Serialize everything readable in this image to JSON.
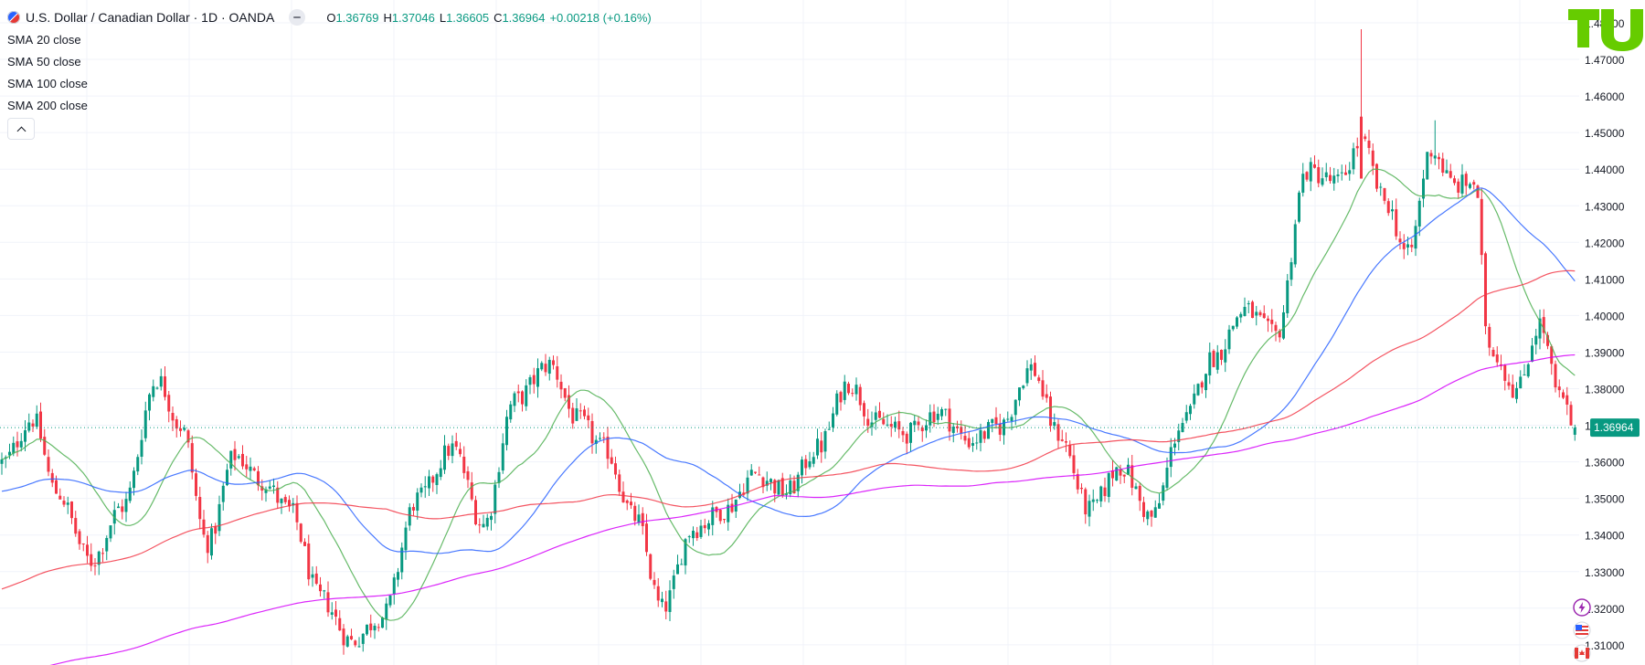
{
  "header": {
    "symbol_title": "U.S. Dollar / Canadian Dollar · 1D · OANDA",
    "open_label": "O",
    "open_value": "1.36769",
    "high_label": "H",
    "high_value": "1.37046",
    "low_label": "L",
    "low_value": "1.36605",
    "close_label": "C",
    "close_value": "1.36964",
    "change": "+0.00218 (+0.16%)"
  },
  "indicators": [
    {
      "name": "SMA",
      "params": "20 close",
      "color": "#4caf50"
    },
    {
      "name": "SMA",
      "params": "50 close",
      "color": "#2962ff"
    },
    {
      "name": "SMA",
      "params": "100 close",
      "color": "#f23645"
    },
    {
      "name": "SMA",
      "params": "200 close",
      "color": "#d500f9"
    }
  ],
  "price_axis": {
    "ticks": [
      "1.48000",
      "1.47000",
      "1.46000",
      "1.45000",
      "1.44000",
      "1.43000",
      "1.42000",
      "1.41000",
      "1.40000",
      "1.39000",
      "1.38000",
      "1.37000",
      "1.36000",
      "1.35000",
      "1.34000",
      "1.33000",
      "1.32000",
      "1.31000"
    ],
    "current_price_label": "1.36964"
  },
  "colors": {
    "up": "#089981",
    "down": "#f23645",
    "grid": "#f0f3fa",
    "axis_text": "#131722",
    "price_line": "#089981"
  },
  "icons": {
    "logo": "tradingview-logo",
    "side": [
      "lightning-icon",
      "us-flag-icon",
      "canada-flag-icon"
    ]
  },
  "chart_data": {
    "type": "candlestick",
    "interval": "1D",
    "ylim": [
      1.305,
      1.482
    ],
    "grid": true,
    "last_close": 1.36964,
    "key_points": [
      {
        "i": 0,
        "price": 1.36
      },
      {
        "i": 8,
        "price": 1.372
      },
      {
        "i": 14,
        "price": 1.352
      },
      {
        "i": 23,
        "price": 1.333
      },
      {
        "i": 31,
        "price": 1.348
      },
      {
        "i": 40,
        "price": 1.383
      },
      {
        "i": 46,
        "price": 1.37
      },
      {
        "i": 53,
        "price": 1.338
      },
      {
        "i": 60,
        "price": 1.362
      },
      {
        "i": 67,
        "price": 1.355
      },
      {
        "i": 74,
        "price": 1.347
      },
      {
        "i": 82,
        "price": 1.323
      },
      {
        "i": 90,
        "price": 1.311
      },
      {
        "i": 98,
        "price": 1.318
      },
      {
        "i": 107,
        "price": 1.35
      },
      {
        "i": 116,
        "price": 1.364
      },
      {
        "i": 124,
        "price": 1.343
      },
      {
        "i": 132,
        "price": 1.377
      },
      {
        "i": 141,
        "price": 1.387
      },
      {
        "i": 148,
        "price": 1.372
      },
      {
        "i": 155,
        "price": 1.364
      },
      {
        "i": 163,
        "price": 1.345
      },
      {
        "i": 170,
        "price": 1.32
      },
      {
        "i": 178,
        "price": 1.342
      },
      {
        "i": 186,
        "price": 1.347
      },
      {
        "i": 194,
        "price": 1.357
      },
      {
        "i": 202,
        "price": 1.352
      },
      {
        "i": 210,
        "price": 1.364
      },
      {
        "i": 218,
        "price": 1.382
      },
      {
        "i": 225,
        "price": 1.371
      },
      {
        "i": 233,
        "price": 1.368
      },
      {
        "i": 241,
        "price": 1.374
      },
      {
        "i": 249,
        "price": 1.366
      },
      {
        "i": 257,
        "price": 1.37
      },
      {
        "i": 265,
        "price": 1.386
      },
      {
        "i": 272,
        "price": 1.368
      },
      {
        "i": 280,
        "price": 1.347
      },
      {
        "i": 288,
        "price": 1.359
      },
      {
        "i": 296,
        "price": 1.345
      },
      {
        "i": 304,
        "price": 1.371
      },
      {
        "i": 312,
        "price": 1.389
      },
      {
        "i": 320,
        "price": 1.402
      },
      {
        "i": 328,
        "price": 1.395
      },
      {
        "i": 336,
        "price": 1.44
      },
      {
        "i": 344,
        "price": 1.437
      },
      {
        "i": 350,
        "price": 1.448
      },
      {
        "i": 356,
        "price": 1.432
      },
      {
        "i": 362,
        "price": 1.417
      },
      {
        "i": 368,
        "price": 1.446
      },
      {
        "i": 374,
        "price": 1.436
      },
      {
        "i": 379,
        "price": 1.437
      },
      {
        "i": 383,
        "price": 1.392
      },
      {
        "i": 390,
        "price": 1.38
      },
      {
        "i": 396,
        "price": 1.398
      },
      {
        "i": 401,
        "price": 1.378
      },
      {
        "i": 405,
        "price": 1.37
      }
    ],
    "series": [
      {
        "name": "SMA 20 close",
        "period": 20
      },
      {
        "name": "SMA 50 close",
        "period": 50
      },
      {
        "name": "SMA 100 close",
        "period": 100
      },
      {
        "name": "SMA 200 close",
        "period": 200
      }
    ]
  }
}
